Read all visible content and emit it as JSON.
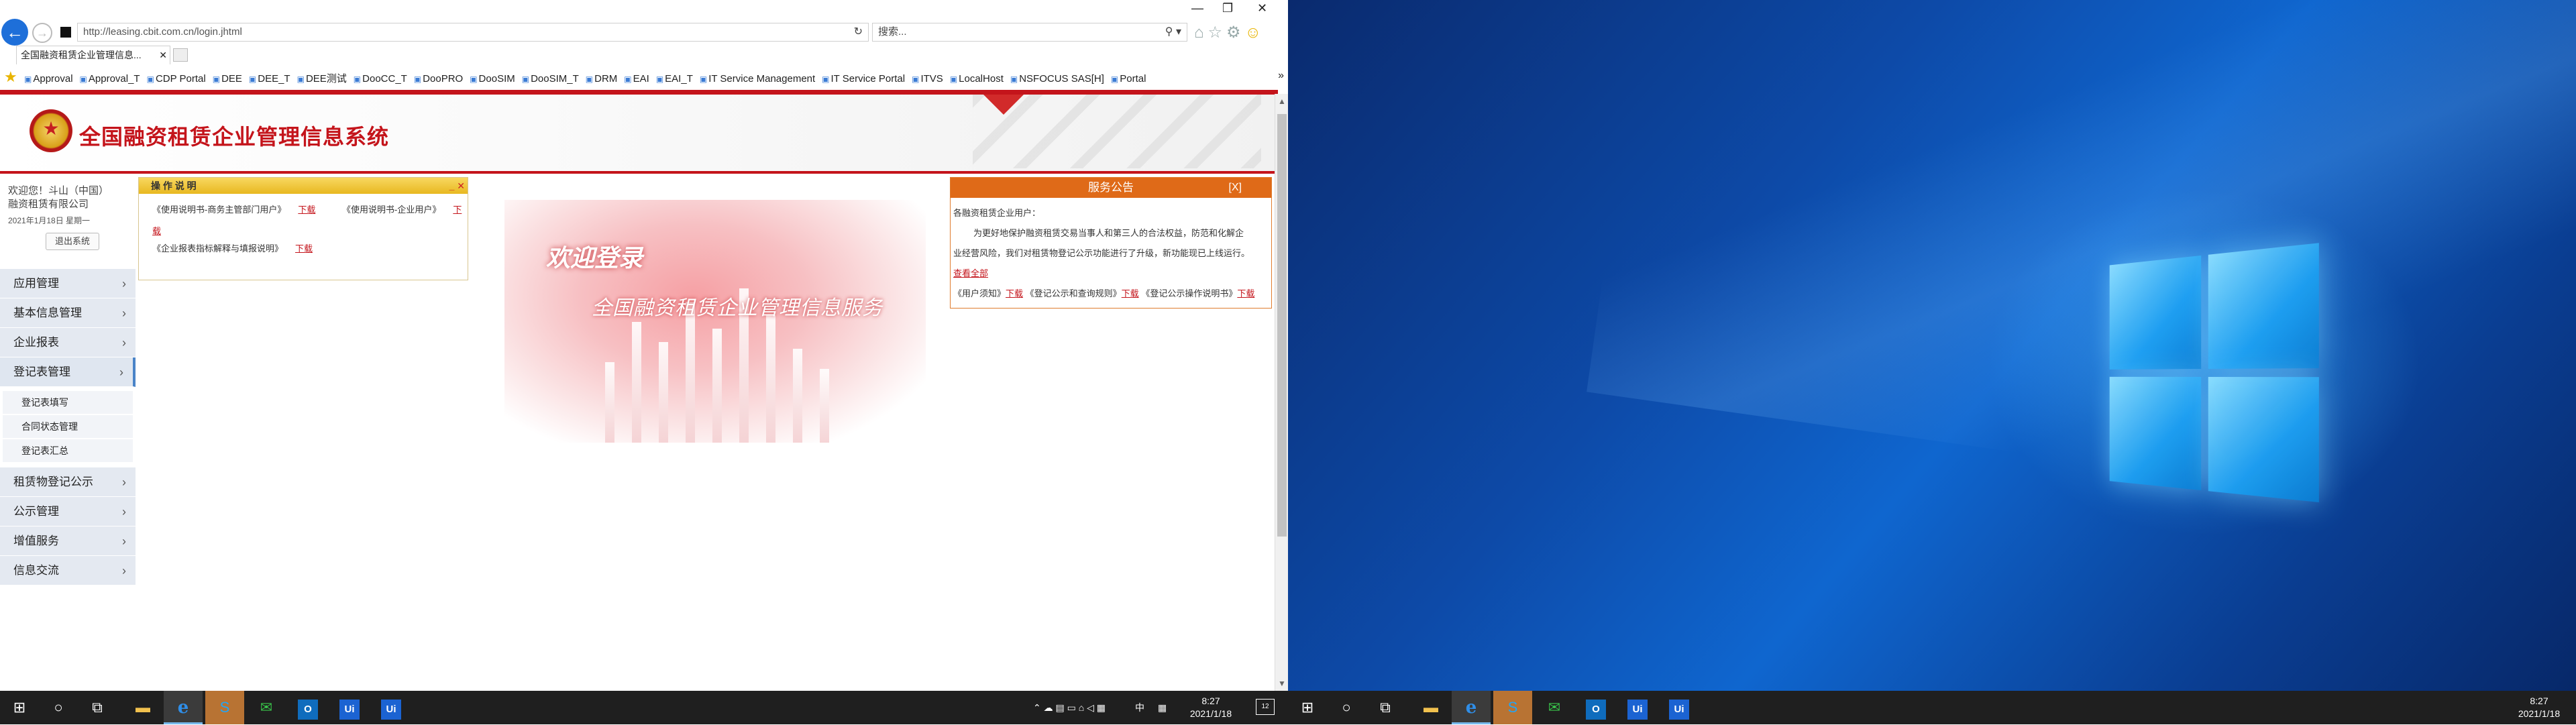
{
  "browser": {
    "url": "http://leasing.cbit.com.cn/login.jhtml",
    "search_placeholder": "搜索...",
    "tab_title": "全国融资租赁企业管理信息...",
    "favorites": [
      "Approval",
      "Approval_T",
      "CDP Portal",
      "DEE",
      "DEE_T",
      "DEE测试",
      "DooCC_T",
      "DooPRO",
      "DooSIM",
      "DooSIM_T",
      "DRM",
      "EAI",
      "EAI_T",
      "IT Service Management",
      "IT Service Portal",
      "ITVS",
      "LocalHost",
      "NSFOCUS SAS[H]",
      "Portal"
    ],
    "more_favorites": "»"
  },
  "site": {
    "system_title": "全国融资租赁企业管理信息系统"
  },
  "sidebar": {
    "welcome_line1": "欢迎您！斗山（中国）",
    "welcome_line2": "融资租赁有限公司",
    "date": "2021年1月18日 星期一",
    "logout_label": "退出系统",
    "menu": [
      {
        "label": "应用管理"
      },
      {
        "label": "基本信息管理"
      },
      {
        "label": "企业报表"
      },
      {
        "label": "登记表管理"
      },
      {
        "label": "租赁物登记公示"
      },
      {
        "label": "公示管理"
      },
      {
        "label": "增值服务"
      },
      {
        "label": "信息交流"
      }
    ],
    "submenu": [
      "登记表填写",
      "合同状态管理",
      "登记表汇总"
    ]
  },
  "operation_panel": {
    "title": "操 作 说 明",
    "items": [
      {
        "text": "《使用说明书-商务主管部门用户》",
        "link": "下载"
      },
      {
        "text": "《使用说明书-企业用户》",
        "link": "下载"
      },
      {
        "text": "《企业报表指标解释与填报说明》",
        "link": "下载"
      }
    ]
  },
  "banner": {
    "welcome": "欢迎登录",
    "subtitle": "全国融资租赁企业管理信息服务"
  },
  "notice_panel": {
    "title": "服务公告",
    "close": "[X]",
    "greeting": "各融资租赁企业用户：",
    "body_line1": "为更好地保护融资租赁交易当事人和第三人的合法权益，防范和化解企",
    "body_line2": "业经营风险，我们对租赁物登记公示功能进行了升级，新功能现已上线运行。",
    "view_all": "查看全部",
    "docs": [
      {
        "text": "《用户须知》",
        "link": "下载"
      },
      {
        "text": "《登记公示和查询规则》",
        "link": "下载"
      },
      {
        "text": "《登记公示操作说明书》",
        "link": "下载"
      }
    ]
  },
  "taskbar_left": {
    "ime": "中",
    "time": "8:27",
    "date": "2021/1/18",
    "notifications": "12"
  },
  "taskbar_right": {
    "time": "8:27",
    "date": "2021/1/18"
  }
}
